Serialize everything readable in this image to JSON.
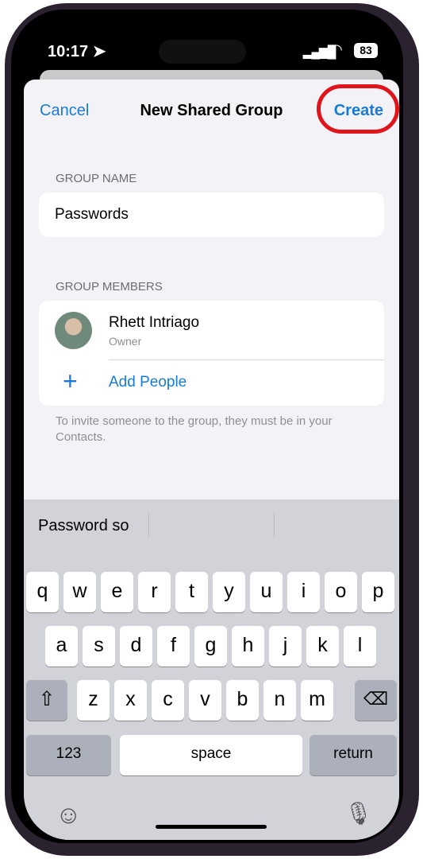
{
  "status": {
    "time": "10:17",
    "battery": "83",
    "icons": [
      "location-arrow-icon",
      "cellular-signal-icon",
      "wifi-icon",
      "battery-icon"
    ]
  },
  "nav": {
    "cancel": "Cancel",
    "title": "New Shared Group",
    "create": "Create",
    "highlight_color": "#e0141a"
  },
  "group_name": {
    "label": "GROUP NAME",
    "value": "Passwords"
  },
  "group_members": {
    "label": "GROUP MEMBERS",
    "members": [
      {
        "name": "Rhett Intriago",
        "role": "Owner"
      }
    ],
    "add_people": "Add People",
    "footer": "To invite someone to the group, they must be in your Contacts."
  },
  "keyboard": {
    "suggestion": "Password so",
    "row1": [
      "q",
      "w",
      "e",
      "r",
      "t",
      "y",
      "u",
      "i",
      "o",
      "p"
    ],
    "row2": [
      "a",
      "s",
      "d",
      "f",
      "g",
      "h",
      "j",
      "k",
      "l"
    ],
    "row3": [
      "z",
      "x",
      "c",
      "v",
      "b",
      "n",
      "m"
    ],
    "numbers": "123",
    "space": "space",
    "return": "return"
  },
  "accent": "#1a7bd6"
}
